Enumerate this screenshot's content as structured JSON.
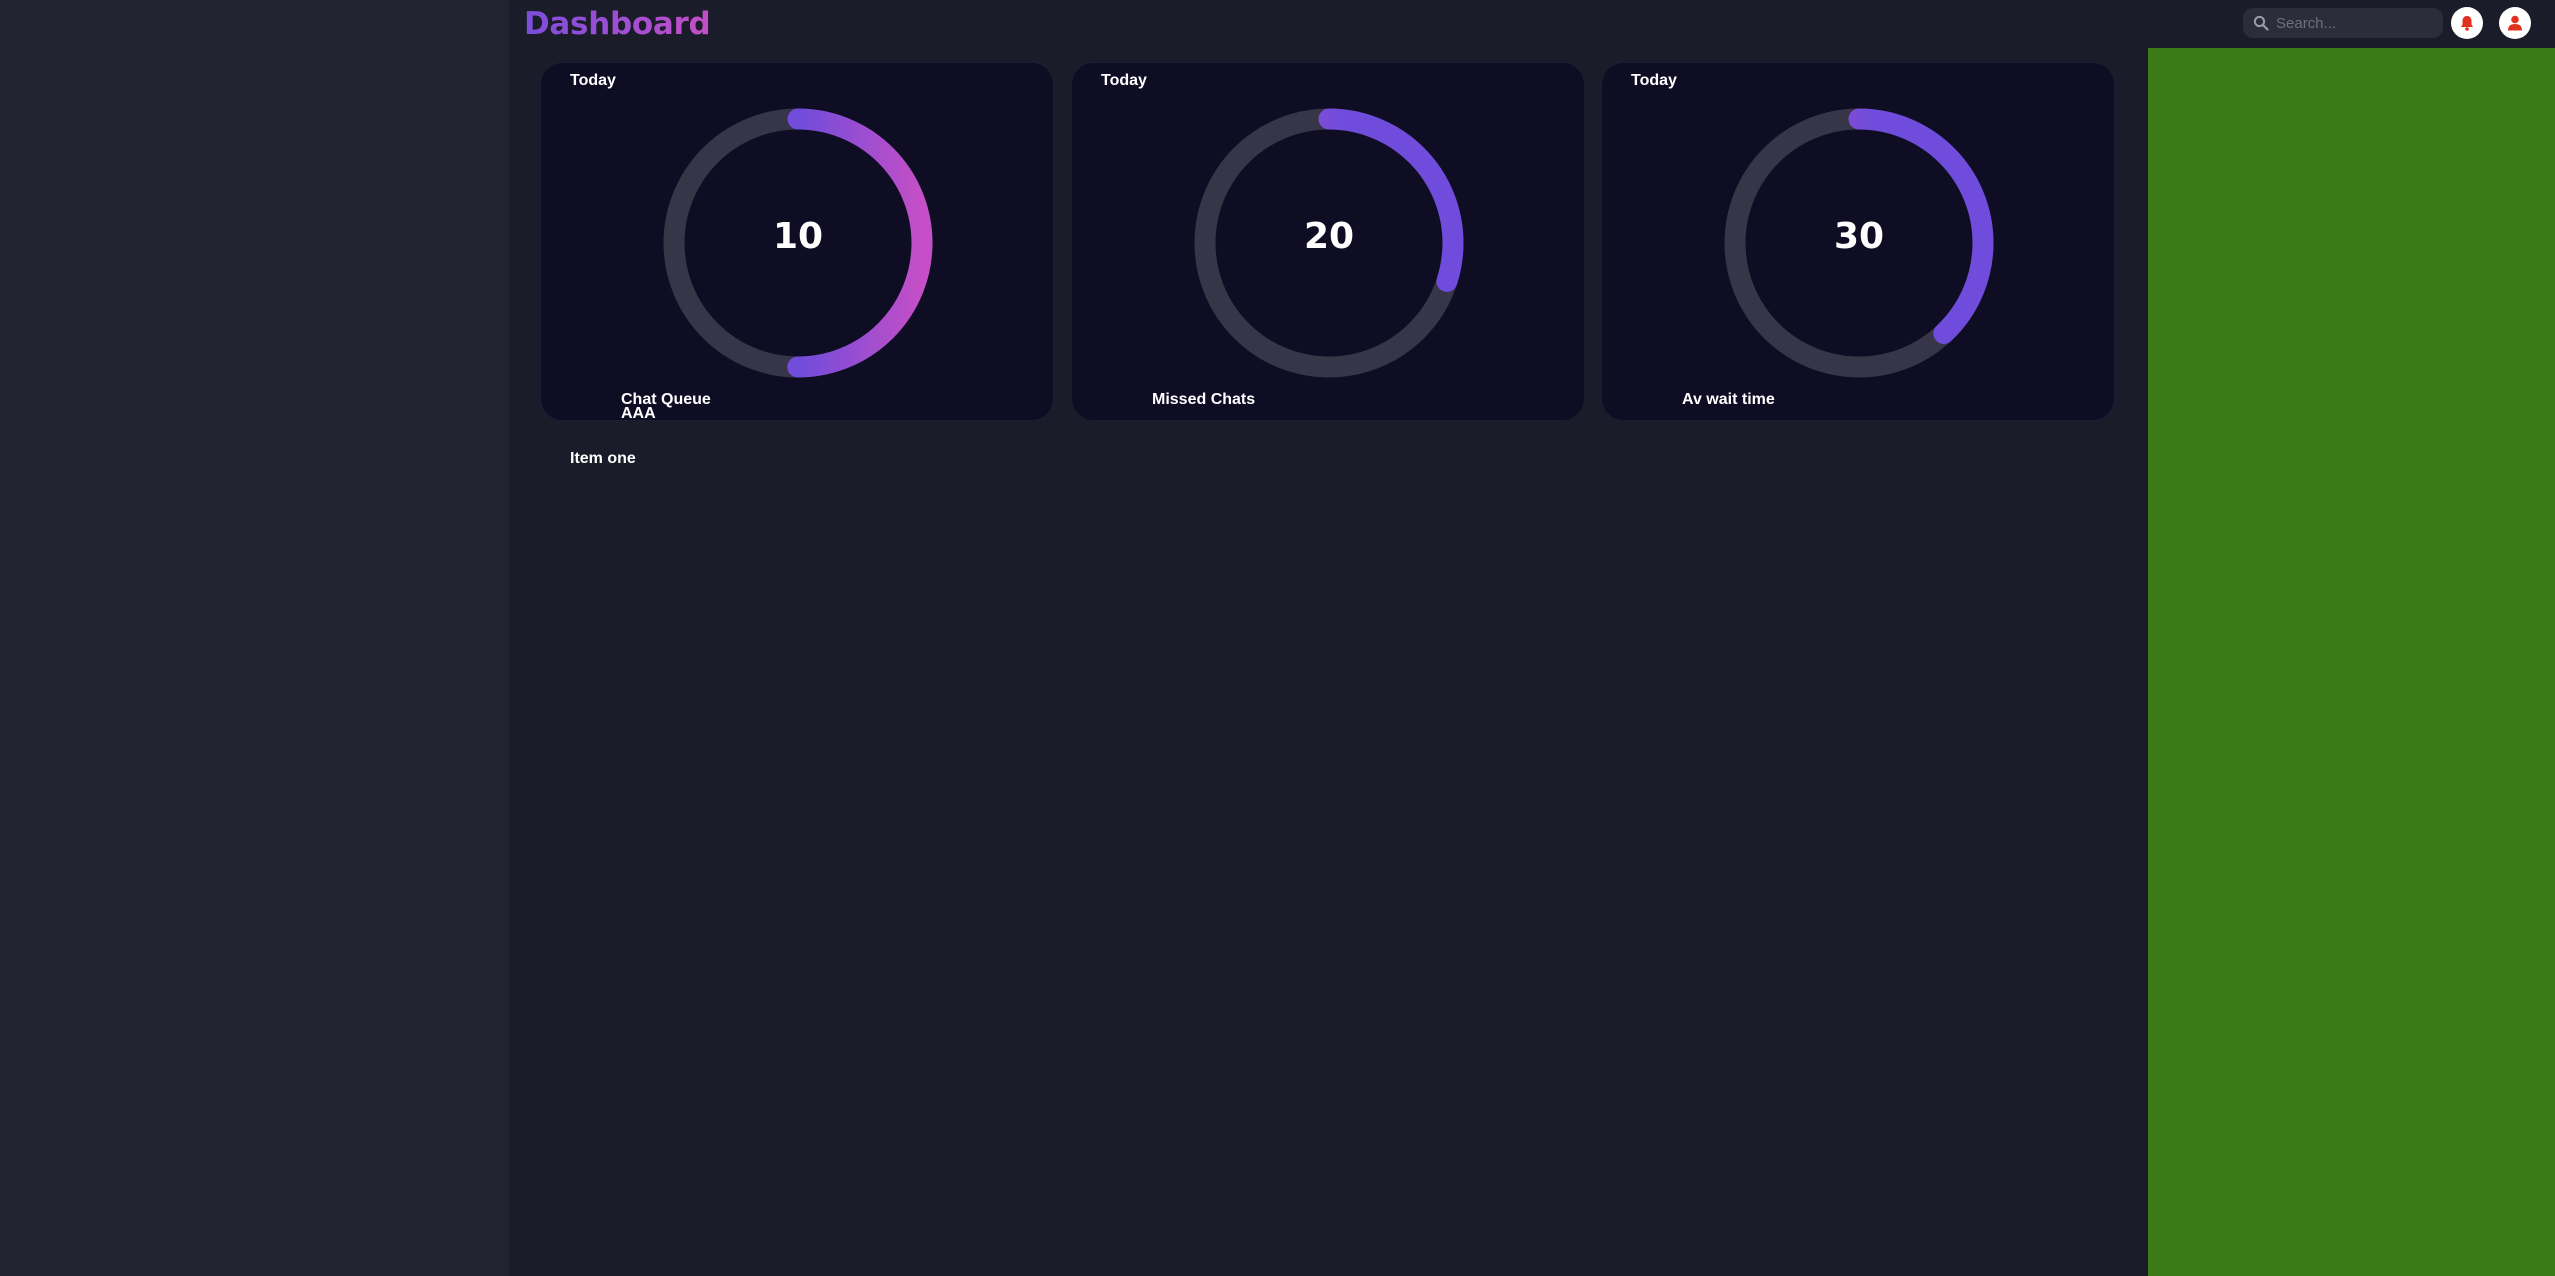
{
  "header": {
    "title": "Dashboard",
    "search_placeholder": "Search...",
    "search_value": "",
    "notification_icon": "bell-icon",
    "profile_icon": "user-icon"
  },
  "cards": [
    {
      "period": "Today",
      "value": "10",
      "progress": 0.5,
      "label": "Chat Queue",
      "sublabel": "AAA"
    },
    {
      "period": "Today",
      "value": "20",
      "progress": 0.3,
      "label": "Missed Chats",
      "sublabel": ""
    },
    {
      "period": "Today",
      "value": "30",
      "progress": 0.38,
      "label": "Av wait time",
      "sublabel": ""
    }
  ],
  "list": {
    "item_one": "Item one"
  },
  "colors": {
    "background": "#1b1c29",
    "sidebar": "#222331",
    "card": "#0f0d24",
    "track": "#373548",
    "gradient_start": "#c54fc6",
    "gradient_end": "#6f4cdb",
    "right_panel": "#3a7a17",
    "icon_red": "#e0301e"
  }
}
